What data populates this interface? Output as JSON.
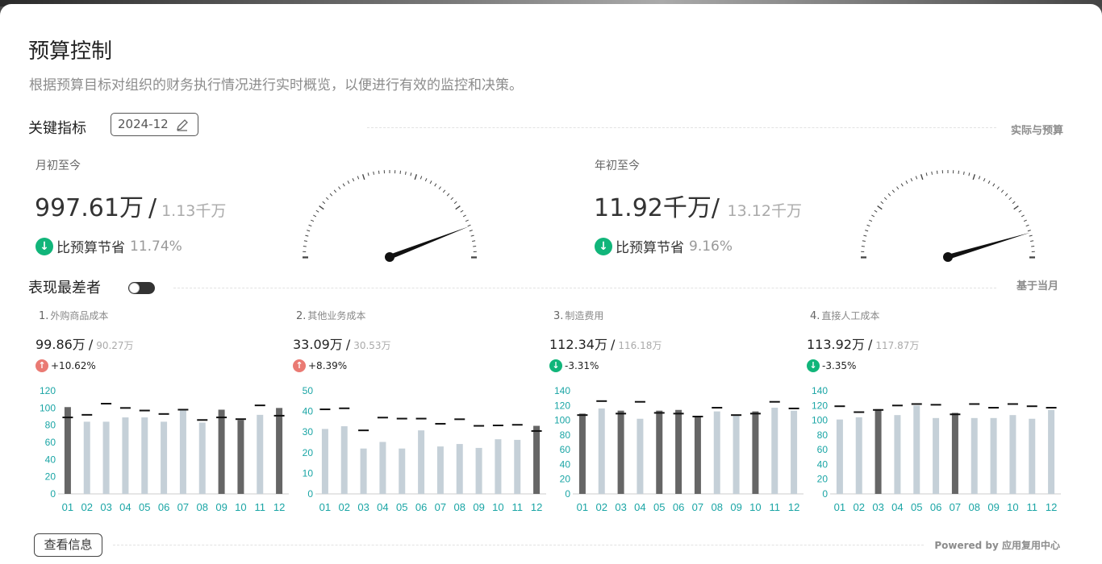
{
  "page": {
    "title": "预算控制",
    "subtitle": "根据预算目标对组织的财务执行情况进行实时概览，以便进行有效的监控和决策。"
  },
  "key_metrics": {
    "title": "关键指标",
    "date": "2024-12",
    "right_label": "实际与预算",
    "mtd": {
      "label": "月初至今",
      "actual": "997.61万",
      "separator": "/",
      "budget": "1.13千万",
      "status": "比预算节省",
      "pct": "11.74%",
      "gauge_ratio": 0.883
    },
    "ytd": {
      "label": "年初至今",
      "actual": "11.92千万",
      "separator": "/",
      "budget": "13.12千万",
      "status": "比预算节省",
      "pct": "9.16%",
      "gauge_ratio": 0.908
    }
  },
  "worst": {
    "title": "表现最差者",
    "right_label": "基于当月",
    "panels": [
      {
        "rank": "1.",
        "name": "外购商品成本",
        "actual": "99.86万",
        "separator": "/",
        "budget": "90.27万",
        "pct": "+10.62%",
        "trend": "up"
      },
      {
        "rank": "2.",
        "name": "其他业务成本",
        "actual": "33.09万",
        "separator": "/",
        "budget": "30.53万",
        "pct": "+8.39%",
        "trend": "up"
      },
      {
        "rank": "3.",
        "name": "制造费用",
        "actual": "112.34万",
        "separator": "/",
        "budget": "116.18万",
        "pct": "-3.31%",
        "trend": "down"
      },
      {
        "rank": "4.",
        "name": "直接人工成本",
        "actual": "113.92万",
        "separator": "/",
        "budget": "117.87万",
        "pct": "-3.35%",
        "trend": "down"
      }
    ]
  },
  "footer": {
    "button_label": "查看信息",
    "powered": "Powered by 应用复用中心"
  },
  "colors": {
    "accent_teal": "#1aa5a5",
    "bar_dark": "#666666",
    "bar_light": "#c5d0d8",
    "good_green": "#11b57a",
    "bad_red": "#ea7a73"
  },
  "chart_data": [
    {
      "type": "bar",
      "categories": [
        "01",
        "02",
        "03",
        "04",
        "05",
        "06",
        "07",
        "08",
        "09",
        "10",
        "11",
        "12"
      ],
      "ylim": [
        0,
        120
      ],
      "yticks": [
        0,
        20,
        40,
        60,
        80,
        100,
        120
      ],
      "series": [
        {
          "values": [
            101,
            84,
            84,
            89,
            89,
            84,
            97,
            83,
            98,
            86,
            92,
            100
          ]
        },
        {
          "values": [
            89,
            92,
            105,
            100,
            97,
            93,
            98,
            86,
            89,
            87,
            103,
            91
          ]
        }
      ],
      "highlight": [
        true,
        false,
        false,
        false,
        false,
        false,
        false,
        false,
        true,
        true,
        false,
        true
      ]
    },
    {
      "type": "bar",
      "categories": [
        "01",
        "02",
        "03",
        "04",
        "05",
        "06",
        "07",
        "08",
        "09",
        "10",
        "11",
        "12"
      ],
      "ylim": [
        0,
        50
      ],
      "yticks": [
        0,
        10,
        20,
        30,
        40,
        50
      ],
      "series": [
        {
          "values": [
            31.5,
            32.8,
            22,
            25.2,
            22,
            30.8,
            23,
            24.2,
            22.3,
            26.5,
            26.2,
            33
          ]
        },
        {
          "values": [
            41,
            41.5,
            30.8,
            37,
            36.5,
            36.5,
            34,
            36.2,
            33,
            33.2,
            33.5,
            30.5
          ]
        }
      ],
      "highlight": [
        false,
        false,
        false,
        false,
        false,
        false,
        false,
        false,
        false,
        false,
        false,
        true
      ]
    },
    {
      "type": "bar",
      "categories": [
        "01",
        "02",
        "03",
        "04",
        "05",
        "06",
        "07",
        "08",
        "09",
        "10",
        "11",
        "12"
      ],
      "ylim": [
        0,
        140
      ],
      "yticks": [
        0,
        20,
        40,
        60,
        80,
        100,
        120,
        140
      ],
      "series": [
        {
          "values": [
            109,
            116,
            113,
            102,
            113,
            114,
            106,
            112,
            106,
            112,
            117,
            113
          ]
        },
        {
          "values": [
            107,
            126,
            109,
            125,
            110,
            109,
            105,
            117,
            107,
            109,
            125,
            116
          ]
        }
      ],
      "highlight": [
        true,
        false,
        true,
        false,
        true,
        true,
        true,
        false,
        false,
        true,
        false,
        false
      ]
    },
    {
      "type": "bar",
      "categories": [
        "01",
        "02",
        "03",
        "04",
        "05",
        "06",
        "07",
        "08",
        "09",
        "10",
        "11",
        "12"
      ],
      "ylim": [
        0,
        140
      ],
      "yticks": [
        0,
        20,
        40,
        60,
        80,
        100,
        120,
        140
      ],
      "series": [
        {
          "values": [
            101,
            104,
            115,
            107,
            120,
            103,
            110,
            103,
            103,
            107,
            102,
            114
          ]
        },
        {
          "values": [
            119,
            111,
            114,
            120,
            122,
            121,
            108,
            122,
            117,
            122,
            119,
            117
          ]
        }
      ],
      "highlight": [
        false,
        false,
        true,
        false,
        false,
        false,
        true,
        false,
        false,
        false,
        false,
        false
      ]
    }
  ]
}
